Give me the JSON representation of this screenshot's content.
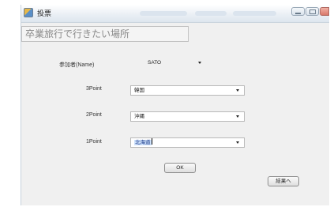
{
  "window": {
    "title": "投票"
  },
  "heading": "卒業旅行で行きたい場所",
  "form": {
    "participant": {
      "label": "参加者(Name)",
      "value": "SATO"
    },
    "point3": {
      "label": "3Point",
      "value": "韓国"
    },
    "point2": {
      "label": "2Point",
      "value": "沖縄"
    },
    "point1": {
      "label": "1Point",
      "value": "北海道"
    }
  },
  "buttons": {
    "ok": "OK",
    "result": "結果へ"
  },
  "icons": {
    "app": "ballot-app-icon",
    "dropdown": "chevron-down-icon"
  }
}
